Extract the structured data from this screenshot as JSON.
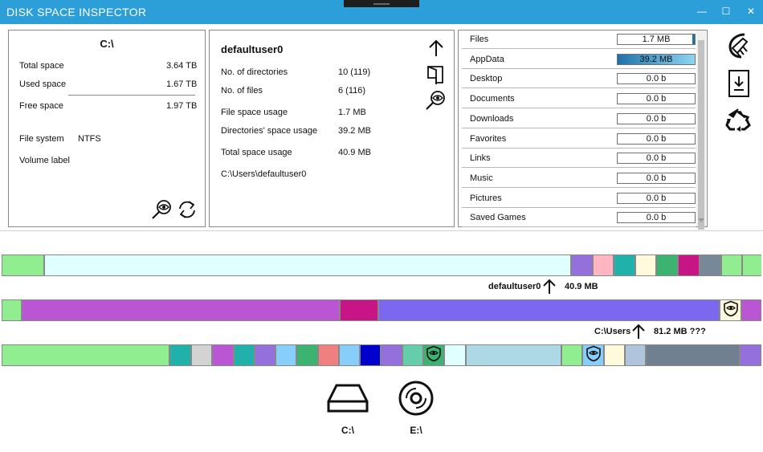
{
  "app": {
    "title": "DISK SPACE INSPECTOR"
  },
  "window": {
    "minimize": "—",
    "maximize": "☐",
    "close": "✕"
  },
  "drive_panel": {
    "drive": "C:\\",
    "total_label": "Total space",
    "total_value": "3.64 TB",
    "used_label": "Used space",
    "used_value": "1.67 TB",
    "free_label": "Free space",
    "free_value": "1.97 TB",
    "fs_label": "File system",
    "fs_value": "NTFS",
    "volume_label": "Volume label"
  },
  "folder_panel": {
    "name": "defaultuser0",
    "dirs_label": "No. of directories",
    "dirs_value": "10 (119)",
    "files_label": "No. of files",
    "files_value": "6 (116)",
    "file_usage_label": "File space usage",
    "file_usage_value": "1.7 MB",
    "dir_usage_label": "Directories' space usage",
    "dir_usage_value": "39.2 MB",
    "total_usage_label": "Total space usage",
    "total_usage_value": "40.9 MB",
    "path": "C:\\Users\\defaultuser0"
  },
  "folder_list": [
    {
      "name": "Files",
      "size": "1.7 MB",
      "fill": 0.0,
      "edge": true
    },
    {
      "name": "AppData",
      "size": "39.2 MB",
      "fill": 1.0,
      "edge": false,
      "selected": true
    },
    {
      "name": "Desktop",
      "size": "0.0 b",
      "fill": 0.0
    },
    {
      "name": "Documents",
      "size": "0.0 b",
      "fill": 0.0
    },
    {
      "name": "Downloads",
      "size": "0.0 b",
      "fill": 0.0
    },
    {
      "name": "Favorites",
      "size": "0.0 b",
      "fill": 0.0
    },
    {
      "name": "Links",
      "size": "0.0 b",
      "fill": 0.0
    },
    {
      "name": "Music",
      "size": "0.0 b",
      "fill": 0.0
    },
    {
      "name": "Pictures",
      "size": "0.0 b",
      "fill": 0.0
    },
    {
      "name": "Saved Games",
      "size": "0.0 b",
      "fill": 0.0
    }
  ],
  "breadcrumbs": {
    "level1": {
      "name": "defaultuser0",
      "size": "40.9 MB"
    },
    "level2": {
      "name": "C:\\Users",
      "size": "81.2 MB ???"
    }
  },
  "colors": {
    "titlebar": "#2d9fd8",
    "row1": [
      "#90ee90",
      "#e0ffff",
      "#9370db",
      "#ffb6c1",
      "#20b2aa",
      "#fffadc",
      "#3cb371",
      "#c71585",
      "#778899",
      "#90ee90",
      "#90ee90"
    ],
    "row2": [
      "#90ee90",
      "#ba55d3",
      "#c71585",
      "#7b68ee",
      "#fffadc",
      "#ba55d3"
    ],
    "row3": [
      "#90ee90",
      "#20b2aa",
      "#d3d3d3",
      "#ba55d3",
      "#20b2aa",
      "#9370db",
      "#87cefa",
      "#3cb371",
      "#f08080",
      "#87cefa",
      "#0000cd",
      "#9370db",
      "#66cdaa",
      "#3cb371",
      "#e0ffff",
      "#add8e6",
      "#90ee90",
      "#87cefa",
      "#fffadc",
      "#b0c4de",
      "#708090",
      "#9370db"
    ]
  },
  "drives": [
    {
      "label": "C:\\",
      "icon": "hard-drive-icon"
    },
    {
      "label": "E:\\",
      "icon": "optical-disc-icon"
    }
  ]
}
